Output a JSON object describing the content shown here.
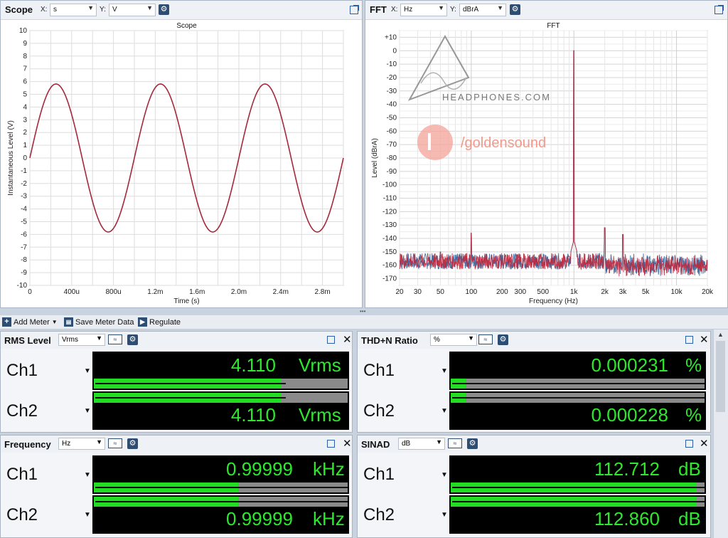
{
  "scope": {
    "title": "Scope",
    "x_label": "X:",
    "x_unit": "s",
    "y_label": "Y:",
    "y_unit": "V",
    "chart_title": "Scope",
    "xlabel": "Time (s)",
    "ylabel": "Instantaneous Level (V)",
    "x_ticks": [
      "0",
      "400u",
      "800u",
      "1.2m",
      "1.6m",
      "2.0m",
      "2.4m",
      "2.8m"
    ],
    "y_ticks": [
      "10",
      "9",
      "8",
      "7",
      "6",
      "5",
      "4",
      "3",
      "2",
      "1",
      "0",
      "-1",
      "-2",
      "-3",
      "-4",
      "-5",
      "-6",
      "-7",
      "-8",
      "-9",
      "-10"
    ]
  },
  "fft": {
    "title": "FFT",
    "x_label": "X:",
    "x_unit": "Hz",
    "y_label": "Y:",
    "y_unit": "dBrA",
    "chart_title": "FFT",
    "xlabel": "Frequency (Hz)",
    "ylabel": "Level (dBrA)",
    "x_ticks": [
      "20",
      "30",
      "50",
      "100",
      "200",
      "300",
      "500",
      "1k",
      "2k",
      "3k",
      "5k",
      "10k",
      "20k"
    ],
    "y_ticks": [
      "+10",
      "0",
      "-10",
      "-20",
      "-30",
      "-40",
      "-50",
      "-60",
      "-70",
      "-80",
      "-90",
      "-100",
      "-110",
      "-120",
      "-130",
      "-140",
      "-150",
      "-160",
      "-170"
    ],
    "watermark1": "HEADPHONES.COM",
    "watermark2": "/goldensound"
  },
  "chart_data": [
    {
      "type": "line",
      "title": "Scope",
      "xlabel": "Time (s)",
      "ylabel": "Instantaneous Level (V)",
      "xlim": [
        0,
        0.003
      ],
      "ylim": [
        -10,
        10
      ],
      "grid": true,
      "series": [
        {
          "amplitude_v": 5.81,
          "frequency_hz": 1000,
          "phase_deg": 0,
          "color": "#a5283c"
        }
      ]
    },
    {
      "type": "line",
      "title": "FFT",
      "xlabel": "Frequency (Hz)",
      "ylabel": "Level (dBrA)",
      "x_scale": "log",
      "xlim": [
        20,
        20000
      ],
      "ylim": [
        -175,
        15
      ],
      "grid": true,
      "noise_floor_dbra": -157,
      "peaks": [
        {
          "x": 50,
          "y": -150
        },
        {
          "x": 100,
          "y": -136
        },
        {
          "x": 1000,
          "y": 0
        },
        {
          "x": 2000,
          "y": -132
        },
        {
          "x": 3000,
          "y": -137
        }
      ],
      "series": [
        {
          "color": "#c0283c"
        },
        {
          "color": "#2e5d9a"
        }
      ]
    }
  ],
  "toolbar": {
    "add_meter": "Add Meter",
    "save_meter": "Save Meter Data",
    "regulate": "Regulate"
  },
  "meters": {
    "rms": {
      "title": "RMS Level",
      "unit": "Vrms",
      "ch1": {
        "label": "Ch1",
        "value": "4.110",
        "unit": "Vrms",
        "fill": 0.74
      },
      "ch2": {
        "label": "Ch2",
        "value": "4.110",
        "unit": "Vrms",
        "fill": 0.74
      }
    },
    "thdn": {
      "title": "THD+N Ratio",
      "unit": "%",
      "ch1": {
        "label": "Ch1",
        "value": "0.000231",
        "unit": "%",
        "fill": 0.06
      },
      "ch2": {
        "label": "Ch2",
        "value": "0.000228",
        "unit": "%",
        "fill": 0.06
      }
    },
    "freq": {
      "title": "Frequency",
      "unit": "Hz",
      "ch1": {
        "label": "Ch1",
        "value": "0.99999",
        "unit": "kHz",
        "fill": 0.57
      },
      "ch2": {
        "label": "Ch2",
        "value": "0.99999",
        "unit": "kHz",
        "fill": 0.57
      }
    },
    "sinad": {
      "title": "SINAD",
      "unit": "dB",
      "ch1": {
        "label": "Ch1",
        "value": "112.712",
        "unit": "dB",
        "fill": 0.97
      },
      "ch2": {
        "label": "Ch2",
        "value": "112.860",
        "unit": "dB",
        "fill": 0.97
      }
    }
  }
}
